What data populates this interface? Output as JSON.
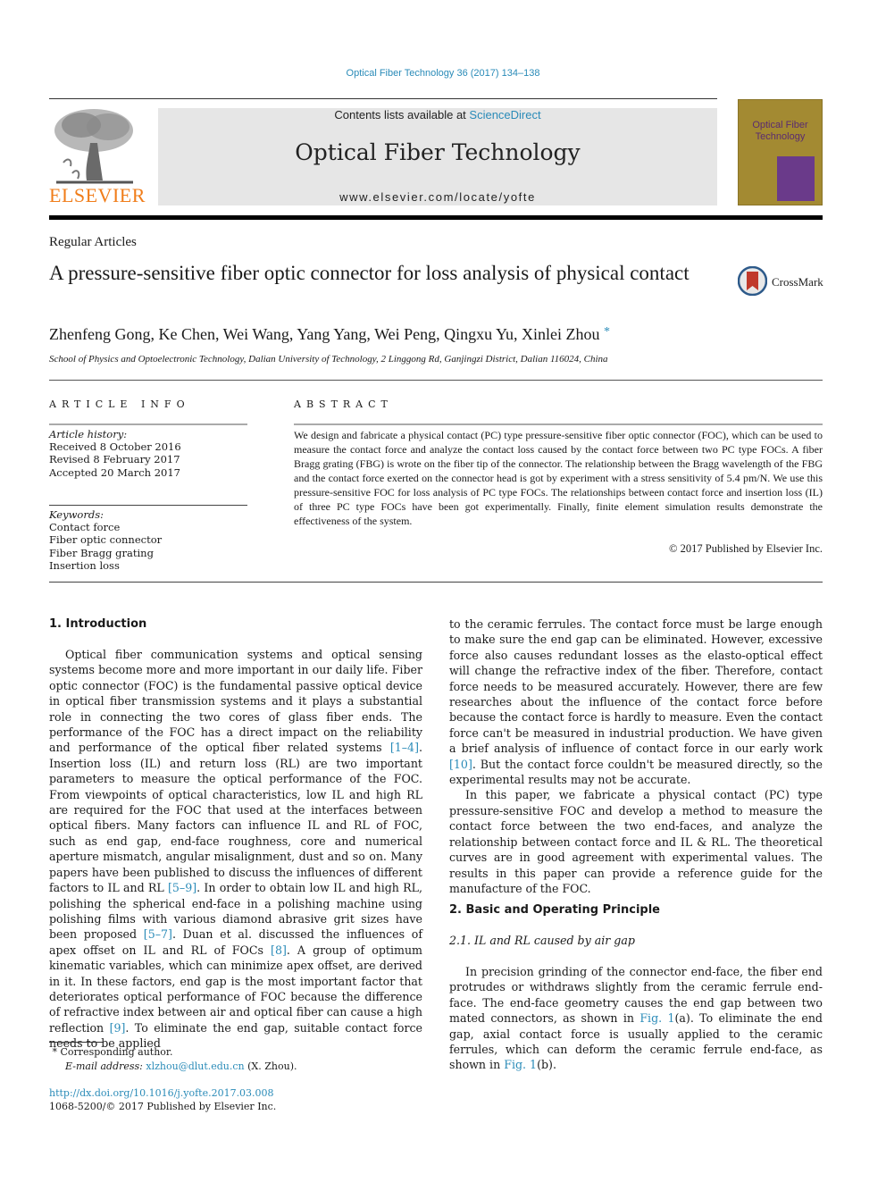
{
  "header": {
    "citation": "Optical Fiber Technology 36 (2017) 134–138",
    "contents_prefix": "Contents lists available at ",
    "contents_link": "ScienceDirect",
    "journal_name": "Optical Fiber Technology",
    "journal_url": "www.elsevier.com/locate/yofte",
    "publisher_logo_text": "ELSEVIER",
    "cover_title_line1": "Optical Fiber",
    "cover_title_line2": "Technology",
    "link_color": "#2a8bb8",
    "publisher_color": "#f07d1a"
  },
  "article": {
    "section_label": "Regular Articles",
    "title": "A pressure-sensitive fiber optic connector for loss analysis of physical contact",
    "crossmark_label": "CrossMark",
    "authors": "Zhenfeng Gong, Ke Chen, Wei Wang, Yang Yang, Wei Peng, Qingxu Yu, Xinlei Zhou",
    "corresponding_marker": "*",
    "affiliation": "School of Physics and Optoelectronic Technology, Dalian University of Technology, 2 Linggong Rd, Ganjingzi District, Dalian 116024, China"
  },
  "article_info": {
    "heading": "ARTICLE INFO",
    "history_label": "Article history:",
    "history": [
      "Received 8 October 2016",
      "Revised 8 February 2017",
      "Accepted 20 March 2017"
    ],
    "keywords_label": "Keywords:",
    "keywords": [
      "Contact force",
      "Fiber optic connector",
      "Fiber Bragg grating",
      "Insertion loss"
    ]
  },
  "abstract": {
    "heading": "ABSTRACT",
    "text": "We design and fabricate a physical contact (PC) type pressure-sensitive fiber optic connector (FOC), which can be used to measure the contact force and analyze the contact loss caused by the contact force between two PC type FOCs. A fiber Bragg grating (FBG) is wrote on the fiber tip of the connector. The relationship between the Bragg wavelength of the FBG and the contact force exerted on the connector head is got by experiment with a stress sensitivity of 5.4 pm/N. We use this pressure-sensitive FOC for loss analysis of PC type FOCs. The relationships between contact force and insertion loss (IL) of three PC type FOCs have been got experimentally. Finally, finite element simulation results demonstrate the effectiveness of the system.",
    "copyright": "© 2017 Published by Elsevier Inc."
  },
  "body": {
    "intro_heading": "1. Introduction",
    "intro_p1_a": "Optical fiber communication systems and optical sensing systems become more and more important in our daily life. Fiber optic connector (FOC) is the fundamental passive optical device in optical fiber transmission systems and it plays a substantial role in connecting the two cores of glass fiber ends. The performance of the FOC has a direct impact on the reliability and performance of the optical fiber related systems ",
    "ref_1_4": "[1–4]",
    "intro_p1_b": ". Insertion loss (IL) and return loss (RL) are two important parameters to measure the optical performance of the FOC. From viewpoints of optical characteristics, low IL and high RL are required for the FOC that used at the interfaces between optical fibers. Many factors can influence IL and RL of FOC, such as end gap, end-face roughness, core and numerical aperture mismatch, angular misalignment, dust and so on. Many papers have been published to discuss the influences of different factors to IL and RL ",
    "ref_5_9": "[5–9]",
    "intro_p1_c": ". In order to obtain low IL and high RL, polishing the spherical end-face in a polishing machine using polishing films with various diamond abrasive grit sizes have been proposed ",
    "ref_5_7": "[5–7]",
    "intro_p1_d": ". Duan et al. discussed the influences of apex offset on IL and RL of FOCs ",
    "ref_8": "[8]",
    "intro_p1_e": ". A group of optimum kinematic variables, which can minimize apex offset, are derived in it. In these factors, end gap is the most important factor that deteriorates optical performance of FOC because the difference of refractive index between air and optical fiber can cause a high reflection ",
    "ref_9": "[9]",
    "intro_p1_f": ". To eliminate the end gap, suitable contact force needs to be applied",
    "right_p1_a": "to the ceramic ferrules. The contact force must be large enough to make sure the end gap can be eliminated. However, excessive force also causes redundant losses as the elasto-optical effect will change the refractive index of the fiber. Therefore, contact force needs to be measured accurately. However, there are few researches about the influence of the contact force before because the contact force is hardly to measure. Even the contact force can't be measured in industrial production. We have given a brief analysis of influence of contact force in our early work ",
    "ref_10": "[10]",
    "right_p1_b": ". But the contact force couldn't be measured directly, so the experimental results may not be accurate.",
    "intro_p2": "In this paper, we fabricate a physical contact (PC) type pressure-sensitive FOC and develop a method to measure the contact force between the two end-faces, and analyze the relationship between contact force and IL & RL. The theoretical curves are in good agreement with experimental values. The results in this paper can provide a reference guide for the manufacture of the FOC.",
    "sec2_heading": "2. Basic and Operating Principle",
    "sec21_heading": "2.1. IL and RL caused by air gap",
    "sec21_p1_a": "In precision grinding of the connector end-face, the fiber end protrudes or withdraws slightly from the ceramic ferrule end-face. The end-face geometry causes the end gap between two mated connectors, as shown in ",
    "fig1_ref_a": "Fig. 1",
    "sec21_p1_b": "(a). To eliminate the end gap, axial contact force is usually applied to the ceramic ferrules, which can deform the ceramic ferrule end-face, as shown in ",
    "fig1_ref_b": "Fig. 1",
    "sec21_p1_c": "(b)."
  },
  "footnotes": {
    "marker": "*",
    "corresponding": "Corresponding author.",
    "email_label": "E-mail address:",
    "email": "xlzhou@dlut.edu.cn",
    "email_suffix": "(X. Zhou).",
    "doi": "http://dx.doi.org/10.1016/j.yofte.2017.03.008",
    "issn_line": "1068-5200/© 2017 Published by Elsevier Inc."
  }
}
